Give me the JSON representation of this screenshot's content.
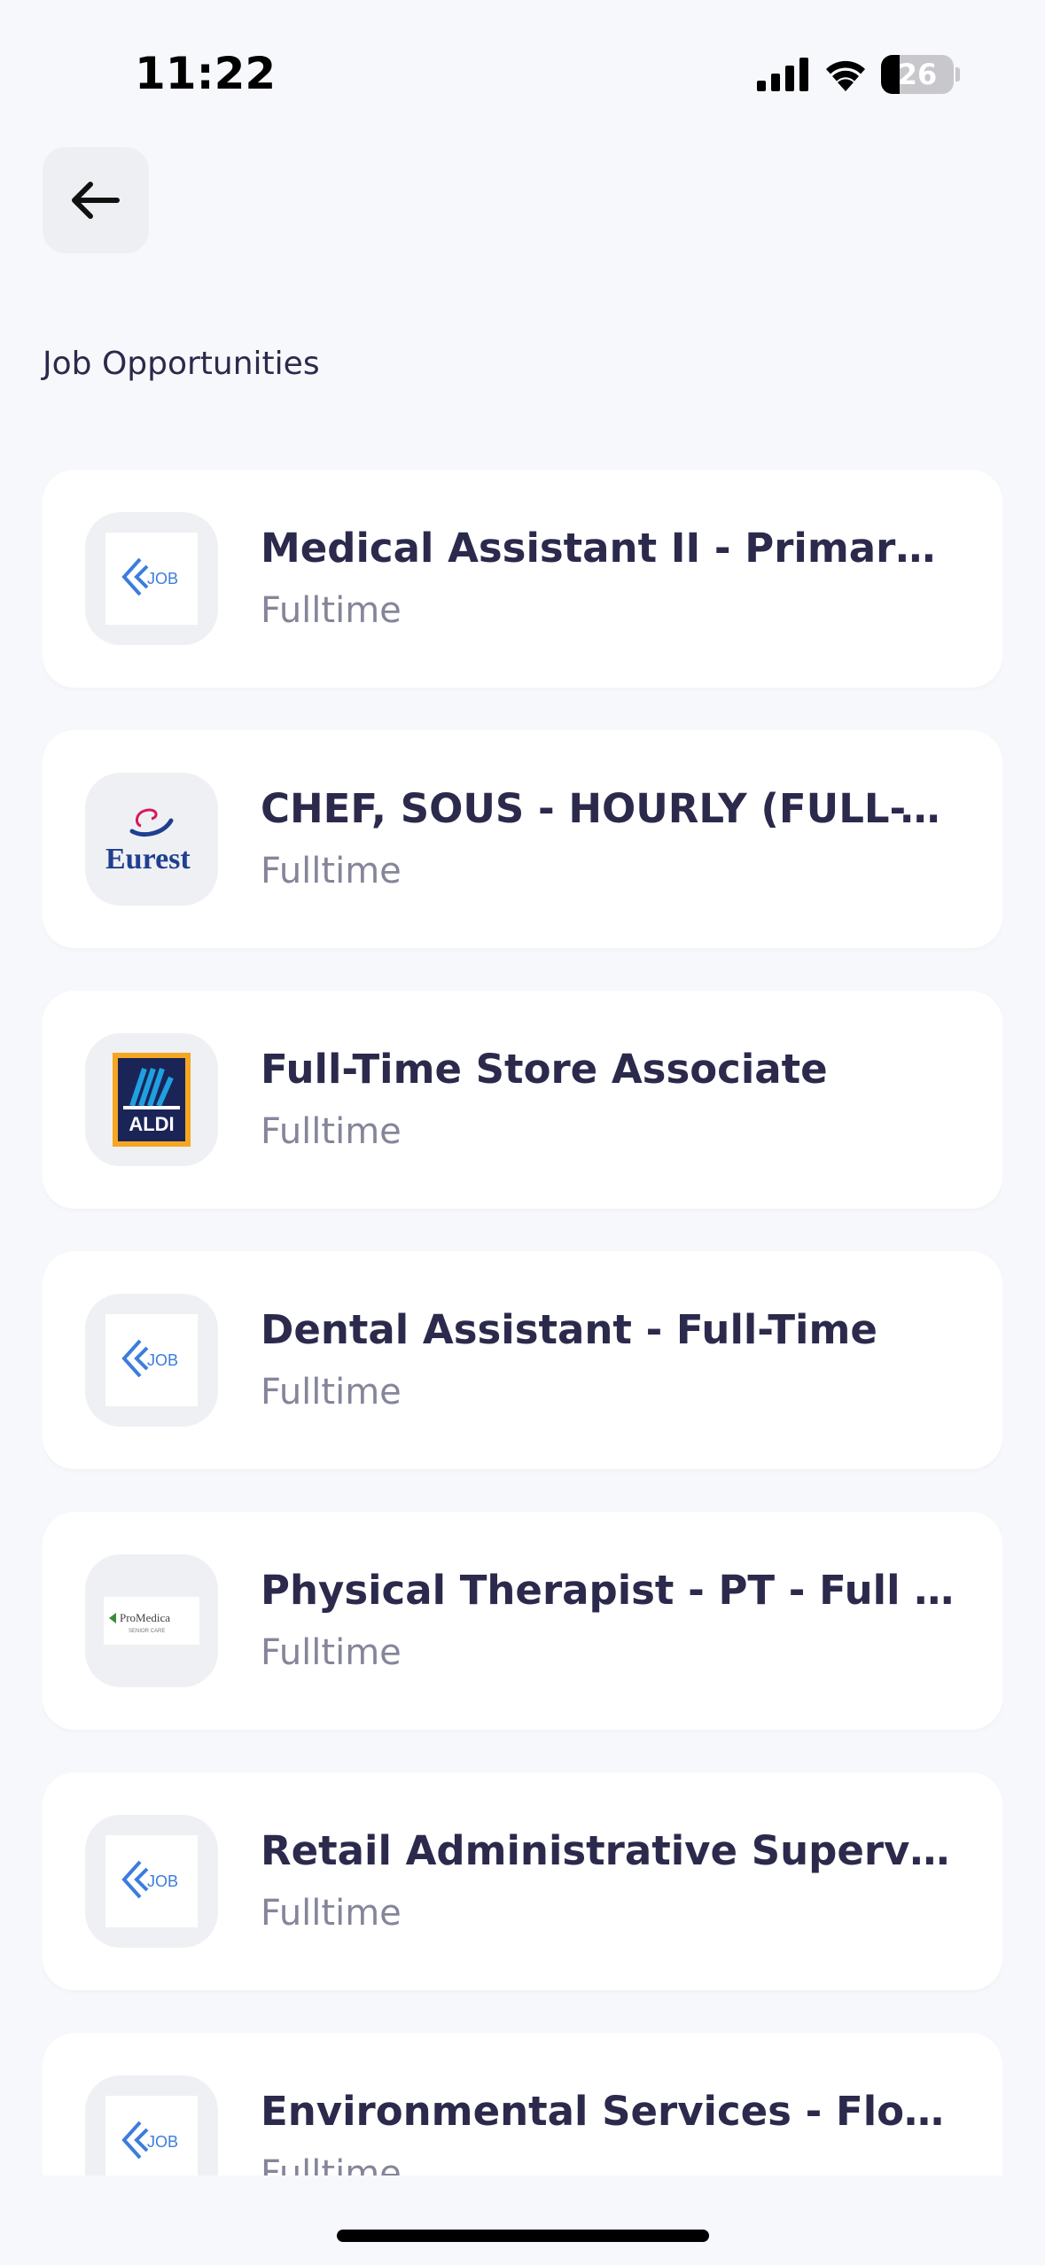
{
  "status_bar": {
    "time": "11:22",
    "battery": "26"
  },
  "header": {
    "title": "Job Opportunities"
  },
  "jobs": [
    {
      "title": "Medical Assistant II - Primary…",
      "type": "Fulltime",
      "logo": "job-logo"
    },
    {
      "title": "CHEF, SOUS - HOURLY (FULL-TI…",
      "type": "Fulltime",
      "logo": "eurest-logo",
      "logo_text": "Eurest"
    },
    {
      "title": "Full-Time Store Associate",
      "type": "Fulltime",
      "logo": "aldi-logo",
      "logo_text": "ALDI"
    },
    {
      "title": "Dental Assistant - Full-Time",
      "type": "Fulltime",
      "logo": "job-logo"
    },
    {
      "title": "Physical Therapist - PT - Full T…",
      "type": "Fulltime",
      "logo": "promedica-logo",
      "logo_text": "ProMedica",
      "logo_subtext": "SENIOR CARE"
    },
    {
      "title": "Retail Administrative Supervis…",
      "type": "Fulltime",
      "logo": "job-logo"
    },
    {
      "title": "Environmental Services - Floo…",
      "type": "Fulltime",
      "logo": "job-logo"
    }
  ],
  "colors": {
    "background": "#f7f8fb",
    "card": "#ffffff",
    "title_text": "#2b2a4c",
    "secondary_text": "#85859a",
    "job_logo_blue": "#3b7ddd"
  }
}
